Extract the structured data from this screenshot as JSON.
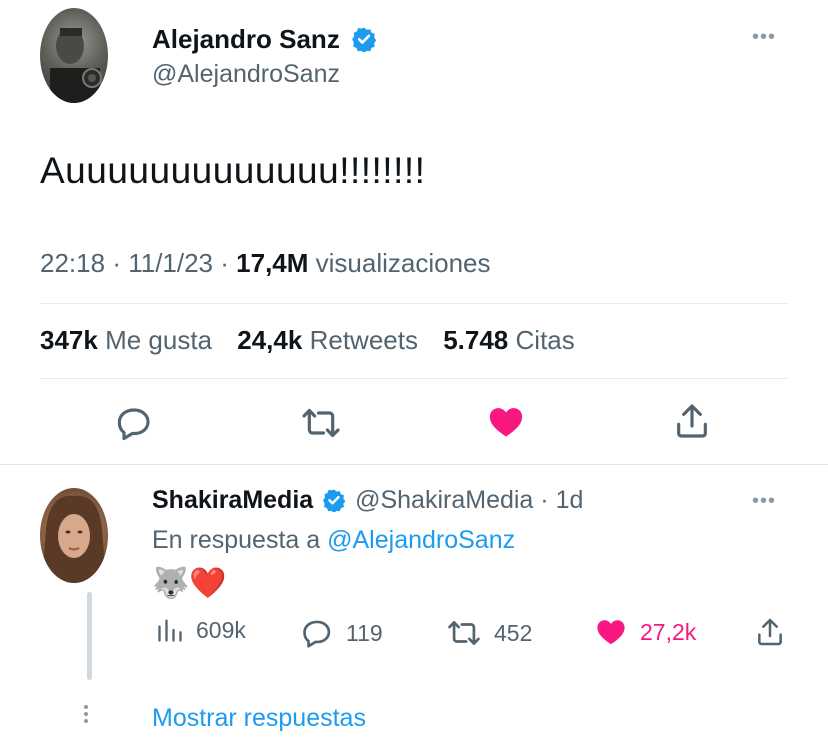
{
  "main_tweet": {
    "author_name": "Alejandro Sanz",
    "handle": "@AlejandroSanz",
    "text": "Auuuuuuuuuuuuu!!!!!!!!",
    "time": "22:18",
    "date": "11/1/23",
    "views_count": "17,4M",
    "views_label": "visualizaciones",
    "likes_count": "347k",
    "likes_label": "Me gusta",
    "retweets_count": "24,4k",
    "retweets_label": "Retweets",
    "quotes_count": "5.748",
    "quotes_label": "Citas",
    "liked": true,
    "icons": [
      "reply-icon",
      "retweet-icon",
      "heart-icon",
      "share-icon"
    ]
  },
  "reply": {
    "author_name": "ShakiraMedia",
    "handle": "@ShakiraMedia",
    "age": "1d",
    "reply_prefix": "En respuesta a",
    "reply_to": "@AlejandroSanz",
    "text": "🐺❤️",
    "views": "609k",
    "replies": "119",
    "retweets": "452",
    "likes": "27,2k",
    "liked": true
  },
  "show_replies_label": "Mostrar respuestas",
  "colors": {
    "accent": "#1d9bf0",
    "like": "#f91880",
    "muted": "#536471",
    "text": "#0f1419"
  }
}
